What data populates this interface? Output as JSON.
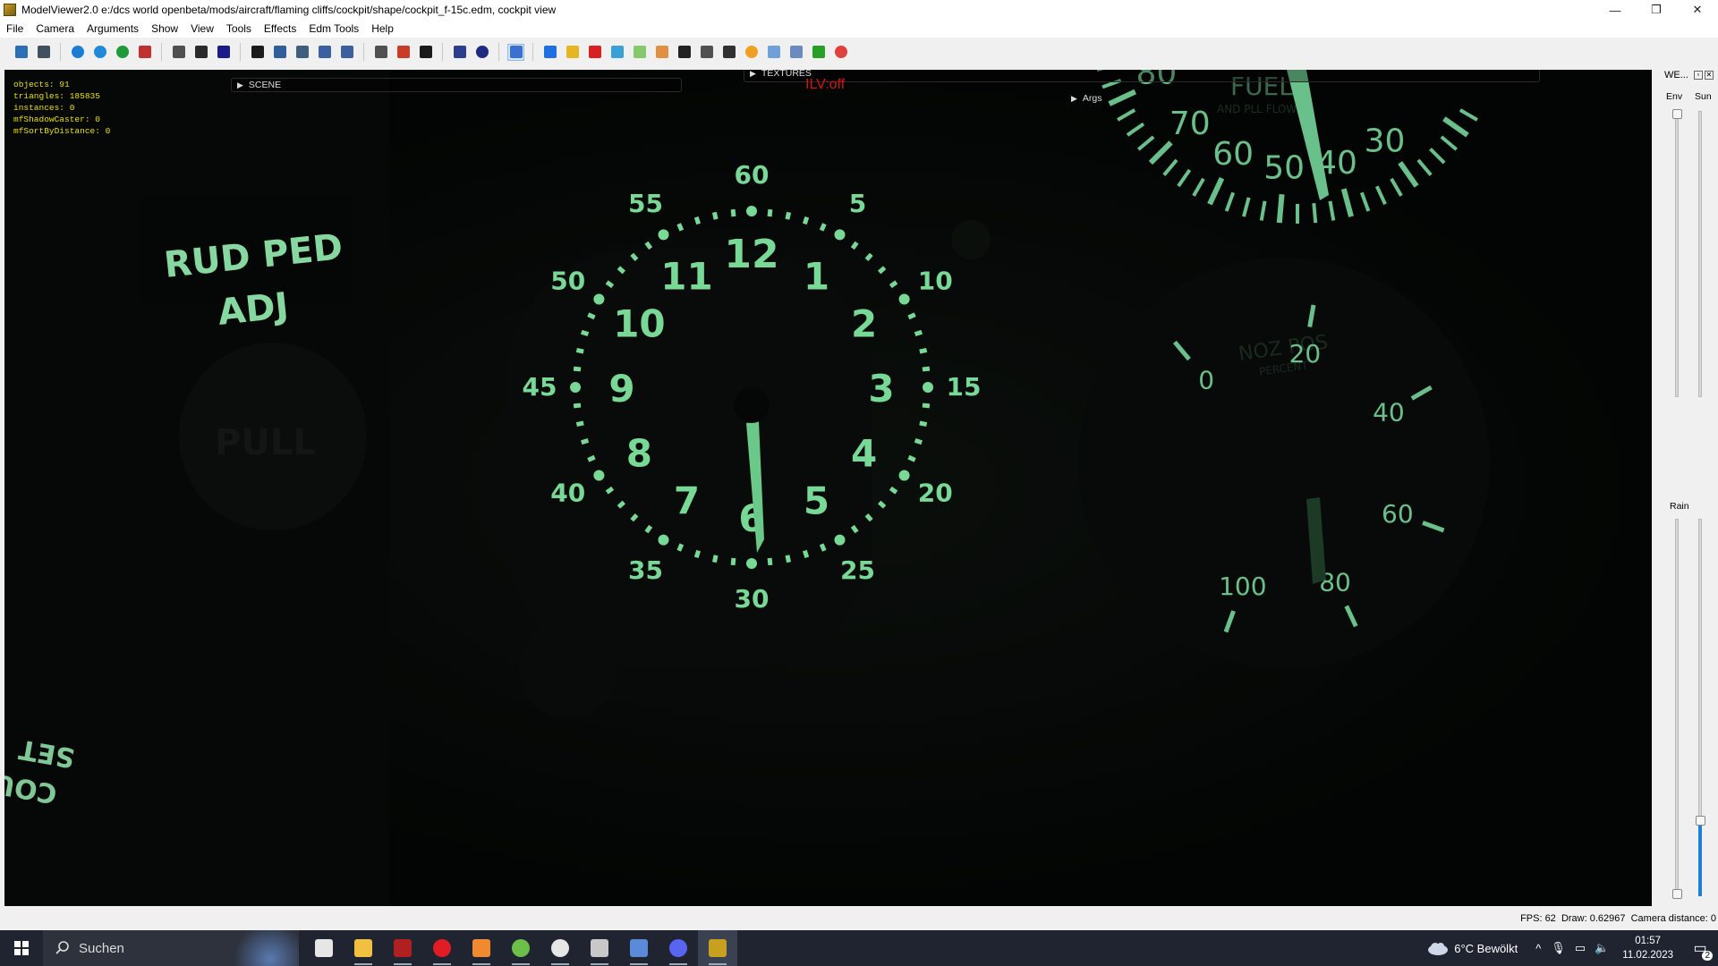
{
  "window": {
    "title": "ModelViewer2.0 e:/dcs world openbeta/mods/aircraft/flaming cliffs/cockpit/shape/cockpit_f-15c.edm, cockpit view",
    "minimize": "—",
    "maximize": "❐",
    "close": "✕"
  },
  "menu": [
    "File",
    "Camera",
    "Arguments",
    "Show",
    "View",
    "Tools",
    "Effects",
    "Edm Tools",
    "Help"
  ],
  "toolbar": {
    "icons": [
      "save-icon",
      "reload-icon",
      "globe-icon",
      "refresh-icon",
      "refresh-green-icon",
      "screenshot-icon",
      "model-icon",
      "camera-icon",
      "crosshair-icon",
      "grid-icon",
      "filter-icon",
      "person-icon",
      "arrow-right-icon",
      "arrow-left-icon",
      "image-icon",
      "colors-icon",
      "monitor-icon",
      "undo-icon",
      "record-icon",
      "bar-chart-icon",
      "cube-blue-icon",
      "copy-icon",
      "cube-red-icon",
      "cube-cyan-icon",
      "box-green-icon",
      "chart-line-icon",
      "pin-icon",
      "tank-icon",
      "car-icon",
      "sphere-icon",
      "network-icon",
      "grid-small-icon",
      "grid-green-icon",
      "target-icon"
    ],
    "colors": [
      "#2d6fb7",
      "#405060",
      "#1a7fd4",
      "#1f8ad8",
      "#1e9a3a",
      "#c03030",
      "#505050",
      "#2b2b2b",
      "#1b1b8a",
      "#1c1c1c",
      "#2e5f9a",
      "#3f5e7d",
      "#3c5fa0",
      "#3c5fa0",
      "#505050",
      "#c83c28",
      "#1a1a1a",
      "#2b3f8e",
      "#1f2a80",
      "#3b6fd0",
      "#1f6fe0",
      "#e6b520",
      "#d82020",
      "#3aa0d8",
      "#86c86e",
      "#e09040",
      "#222222",
      "#505050",
      "#303030",
      "#f0a020",
      "#70a0d8",
      "#6a8ac0",
      "#26a026",
      "#e04040"
    ]
  },
  "viewport": {
    "stats": {
      "objects": "objects: 91",
      "triangles": "triangles: 185835",
      "instances": "instances: 0",
      "shadow_caster": "mfShadowCaster: 0",
      "sort_by_distance": "mfSortByDistance: 0"
    },
    "panels": {
      "scene": "SCENE",
      "textures": "TEXTURES",
      "args": "Args"
    },
    "ilv": "ILV:off",
    "cockpit_labels": {
      "rud_ped_1": "RUD PED",
      "rud_ped_2": "ADJ",
      "course_1": "COURSE",
      "course_2": "SET",
      "pull": "PULL",
      "noz_pos": "NOZ POS",
      "percent": "PERCENT",
      "fuel": "FUEL",
      "fuel_sub": "AND PLL FLOW"
    },
    "clock_outer": [
      "60",
      "5",
      "10",
      "15",
      "20",
      "25",
      "30",
      "35",
      "40",
      "45",
      "50",
      "55"
    ],
    "clock_inner": [
      "12",
      "1",
      "2",
      "3",
      "4",
      "5",
      "6",
      "7",
      "8",
      "9",
      "10",
      "11"
    ],
    "noz_scale": [
      "0",
      "20",
      "40",
      "60",
      "80",
      "100"
    ],
    "fuel_scale": [
      "30",
      "40",
      "50",
      "60",
      "70",
      "80"
    ]
  },
  "weather": {
    "title": "WE...",
    "env": "Env",
    "sun": "Sun",
    "rain": "Rain",
    "rain_level": 0.2
  },
  "status": {
    "fps": "FPS: 62",
    "draw": "Draw: 0.62967",
    "camera": "Camera distance: 0"
  },
  "taskbar": {
    "search_placeholder": "Suchen",
    "apps": [
      "task-view-icon",
      "file-explorer-icon",
      "app-red-icon",
      "opera-icon",
      "media-player-icon",
      "xbox-icon",
      "settings-icon",
      "headset-icon",
      "editor-icon",
      "discord-icon",
      "modelviewer-icon"
    ],
    "weather": "6°C  Bewölkt",
    "time": "01:57",
    "date": "11.02.2023",
    "notifications": "2"
  }
}
